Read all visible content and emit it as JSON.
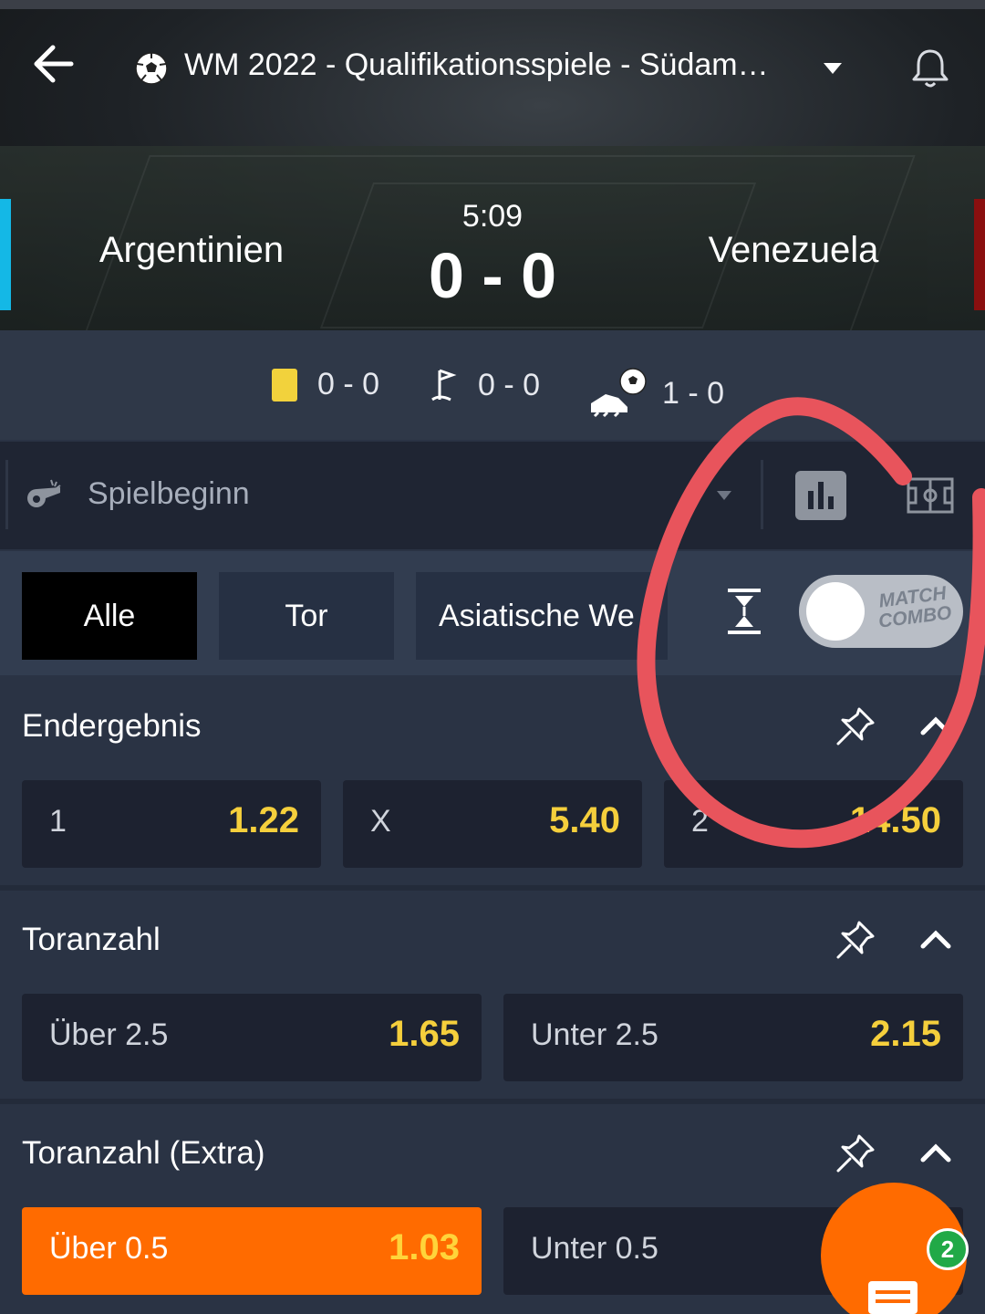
{
  "header": {
    "competition_title": "WM 2022 - Qualifikationsspiele - Südam…",
    "icons": {
      "back": "arrow-left-icon",
      "competition": "soccer-ball-icon",
      "dropdown": "chevron-down-icon",
      "notifications": "bell-icon"
    }
  },
  "match": {
    "home_team": "Argentinien",
    "away_team": "Venezuela",
    "time": "5:09",
    "score": "0 - 0",
    "home_color": "#14b8e6",
    "away_color": "#8a0f0f"
  },
  "stats": {
    "cards": "0 - 0",
    "corners": "0 - 0",
    "kicks": "1 - 0"
  },
  "game_state": {
    "label": "Spielbeginn"
  },
  "tabs": [
    {
      "label": "Alle",
      "active": true
    },
    {
      "label": "Tor",
      "active": false
    },
    {
      "label": "Asiatische We",
      "active": false
    }
  ],
  "match_combo": {
    "line1": "MATCH",
    "line2": "COMBO",
    "enabled": false
  },
  "markets": [
    {
      "title": "Endergebnis",
      "odds": [
        {
          "label": "1",
          "value": "1.22"
        },
        {
          "label": "X",
          "value": "5.40"
        },
        {
          "label": "2",
          "value": "14.50"
        }
      ]
    },
    {
      "title": "Toranzahl",
      "odds": [
        {
          "label": "Über 2.5",
          "value": "1.65"
        },
        {
          "label": "Unter 2.5",
          "value": "2.15"
        }
      ]
    },
    {
      "title": "Toranzahl (Extra)",
      "odds": [
        {
          "label": "Über 0.5",
          "value": "1.03",
          "selected": true
        },
        {
          "label": "Unter 0.5",
          "value": ""
        }
      ]
    }
  ],
  "betslip": {
    "count": "2"
  },
  "colors": {
    "odd_value": "#f5cf3c",
    "selected": "#ff6b00",
    "annotation": "#e8545c"
  }
}
